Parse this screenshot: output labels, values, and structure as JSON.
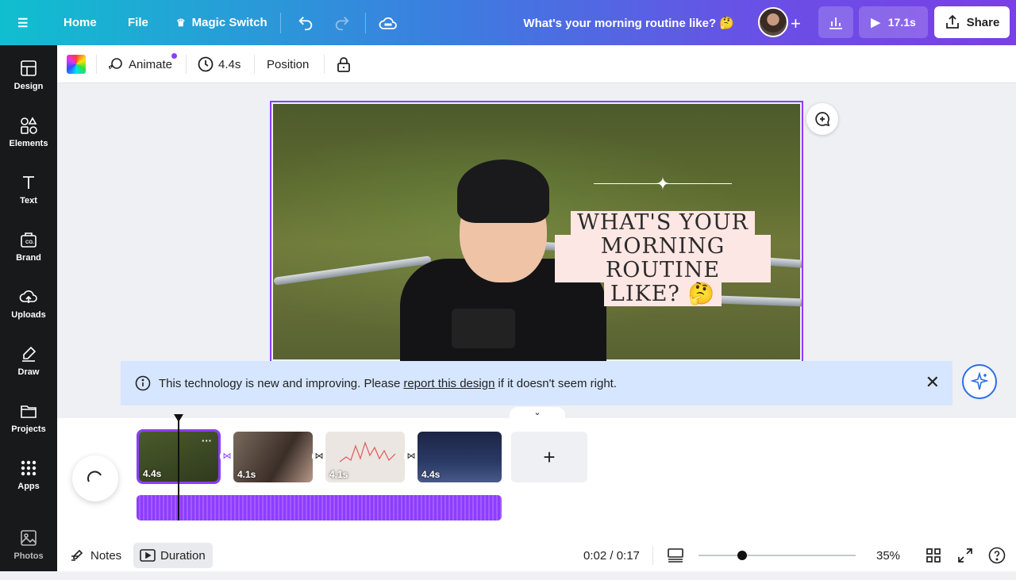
{
  "topbar": {
    "home": "Home",
    "file": "File",
    "magic_switch": "Magic Switch",
    "doc_title": "What's your morning routine like? 🤔",
    "play_duration": "17.1s",
    "share": "Share"
  },
  "sidebar": {
    "items": [
      {
        "label": "Design"
      },
      {
        "label": "Elements"
      },
      {
        "label": "Text"
      },
      {
        "label": "Brand"
      },
      {
        "label": "Uploads"
      },
      {
        "label": "Draw"
      },
      {
        "label": "Projects"
      },
      {
        "label": "Apps"
      },
      {
        "label": "Photos"
      }
    ]
  },
  "toolbar2": {
    "animate": "Animate",
    "duration": "4.4s",
    "position": "Position"
  },
  "canvas": {
    "title_lines": [
      "WHAT'S YOUR",
      "MORNING ROUTINE",
      "LIKE? 🤔"
    ]
  },
  "notice": {
    "text_before": "This technology is new and improving. Please",
    "link": "report this design",
    "text_after": "if it doesn't seem right."
  },
  "timeline": {
    "clips": [
      {
        "duration": "4.4s",
        "color": "#3b4a2a"
      },
      {
        "duration": "4.1s",
        "color": "#6b5a4c"
      },
      {
        "duration": "4.1s",
        "color": "#e8e2de"
      },
      {
        "duration": "4.4s",
        "color": "#1d2a4a"
      }
    ],
    "add": "+"
  },
  "bottombar": {
    "notes": "Notes",
    "duration": "Duration",
    "time": "0:02 / 0:17",
    "zoom": "35%",
    "zoom_level": 0.28
  },
  "colors": {
    "accent": "#8b3dff"
  }
}
